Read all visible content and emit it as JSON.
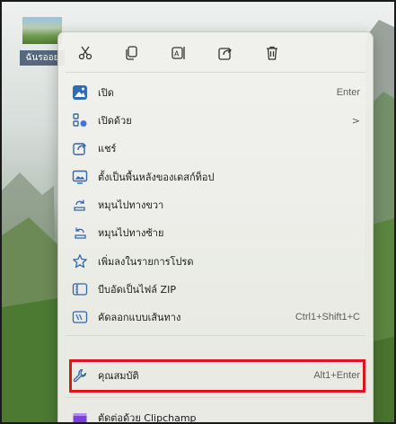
{
  "colors": {
    "menu_background": "#f0f0ec",
    "highlight_border": "#e0141e",
    "icon_blue": "#3367a8",
    "text": "#1b1b1b",
    "shortcut_text": "#5e5e5e"
  },
  "desktop": {
    "icon_label": "ฉันรออย"
  },
  "menu": {
    "quick_actions": [
      {
        "name": "cut-icon"
      },
      {
        "name": "copy-icon"
      },
      {
        "name": "rename-icon"
      },
      {
        "name": "share-icon"
      },
      {
        "name": "delete-icon"
      }
    ],
    "items": [
      {
        "label": "เปิด",
        "shortcut": "Enter",
        "icon": "photo-icon"
      },
      {
        "label": "เปิดด้วย",
        "submenu": ">",
        "icon": "open-with-icon"
      },
      {
        "label": "แชร์",
        "icon": "share-icon"
      },
      {
        "label": "ตั้งเป็นพื้นหลังของเดสก์ท็อป",
        "icon": "desktop-background-icon"
      },
      {
        "label": "หมุนไปทางขวา",
        "icon": "rotate-right-icon"
      },
      {
        "label": "หมุนไปทางซ้าย",
        "icon": "rotate-left-icon"
      },
      {
        "label": "เพิ่มลงในรายการโปรด",
        "icon": "star-icon"
      },
      {
        "label": "บีบอัดเป็นไฟล์ ZIP",
        "icon": "zip-icon"
      },
      {
        "label": "คัดลอกแบบเส้นทาง",
        "shortcut": "Ctrl1+Shift1+C",
        "icon": "copy-path-icon"
      },
      {
        "label": "คุณสมบัติ",
        "shortcut": "Alt1+Enter",
        "icon": "properties-wrench-icon",
        "highlighted": true
      },
      {
        "label": "ตัดต่อด้วย Clipchamp",
        "icon": "clipchamp-icon"
      }
    ]
  }
}
